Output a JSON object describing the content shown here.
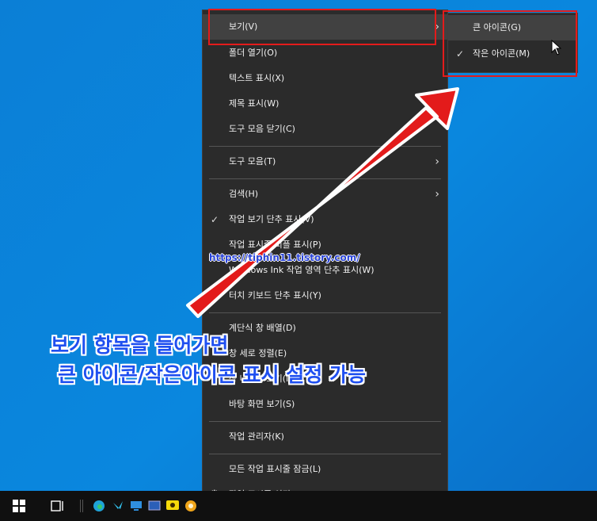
{
  "context_menu": {
    "items": [
      {
        "label": "보기(V)"
      },
      {
        "label": "폴더 열기(O)"
      },
      {
        "label": "텍스트 표시(X)"
      },
      {
        "label": "제목 표시(W)"
      },
      {
        "label": "도구 모음 닫기(C)"
      },
      {
        "label": "도구 모음(T)"
      },
      {
        "label": "검색(H)"
      },
      {
        "label": "작업 보기 단추 표시(V)"
      },
      {
        "label": "작업 표시줄 피플 표시(P)"
      },
      {
        "label": "Windows Ink 작업 영역 단추 표시(W)"
      },
      {
        "label": "터치 키보드 단추 표시(Y)"
      },
      {
        "label": "계단식 창 배열(D)"
      },
      {
        "label": "창 세로 정렬(E)"
      },
      {
        "label": "창 나란히 보기(I)"
      },
      {
        "label": "바탕 화면 보기(S)"
      },
      {
        "label": "작업 관리자(K)"
      },
      {
        "label": "모든 작업 표시줄 잠금(L)"
      },
      {
        "label": "작업 표시줄 설정(T)"
      }
    ]
  },
  "submenu": {
    "items": [
      {
        "label": "큰 아이콘(G)"
      },
      {
        "label": "작은 아이콘(M)"
      }
    ]
  },
  "annotation": {
    "url": "https://tiphin11.tistory.com/",
    "caption_line1": "보기 항목을 들어가면",
    "caption_line2": "큰 아이콘/작은아이콘 표시 설정 가능"
  },
  "colors": {
    "desktop": "#0a84da",
    "menu_bg": "#2b2b2b",
    "highlight_red": "#e31b1b",
    "caption_blue": "#1f4ff0"
  },
  "icons": {
    "start": "windows-logo-icon",
    "task_view": "task-view-icon",
    "edge": "edge-icon",
    "check": "checkmark-icon",
    "chevron": "chevron-right-icon",
    "settings": "gear-icon"
  }
}
